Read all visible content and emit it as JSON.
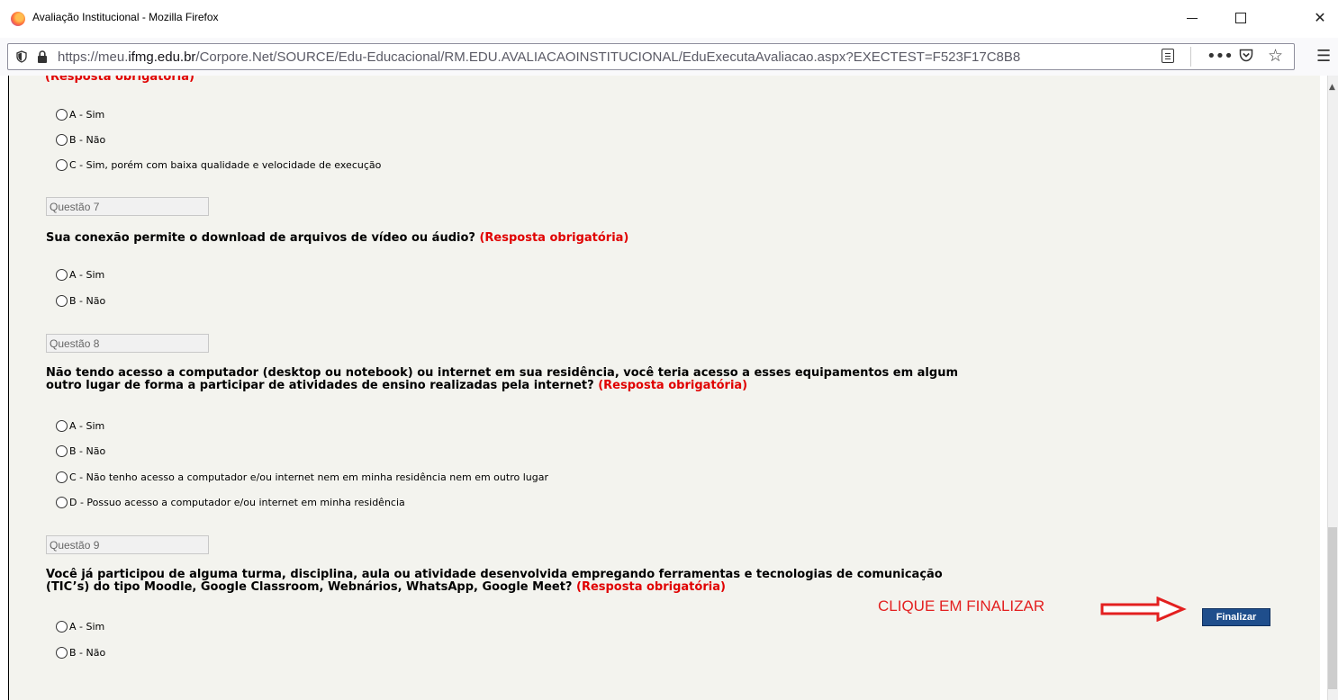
{
  "window": {
    "title": "Avaliação Institucional - Mozilla Firefox",
    "minimize": "",
    "maximize": "",
    "close": "✕"
  },
  "urlbar": {
    "url_prefix": "https://meu.",
    "url_domain": "ifmg.edu.br",
    "url_path": "/Corpore.Net/SOURCE/Edu-Educacional/RM.EDU.AVALIACAOINSTITUCIONAL/EduExecutaAvaliacao.aspx?EXECTEST=F523F17C8B8",
    "more": "•••",
    "star": "☆",
    "menu": "☰"
  },
  "form": {
    "cut_off_text": "(Resposta obrigatória)",
    "q6_options": [
      "A - Sim",
      "B - Não",
      "C - Sim, porém com baixa qualidade e velocidade de execução"
    ],
    "q7": {
      "label": "Questão 7",
      "text": "Sua conexão permite o download de arquivos de vídeo ou áudio?",
      "required": "(Resposta obrigatória)",
      "options": [
        "A - Sim",
        "B - Não"
      ]
    },
    "q8": {
      "label": "Questão 8",
      "text_line1": "Não tendo acesso a computador (desktop ou notebook) ou internet em sua residência, você teria acesso a esses equipamentos em algum",
      "text_line2": "outro lugar de forma a participar de atividades de ensino realizadas pela internet?",
      "required": "(Resposta obrigatória)",
      "options": [
        "A - Sim",
        "B - Não",
        "C - Não tenho acesso a computador e/ou internet nem em minha residência nem em outro lugar",
        "D - Possuo acesso a computador e/ou internet em minha residência"
      ]
    },
    "q9": {
      "label": "Questão 9",
      "text_line1": "Você já participou de alguma turma, disciplina, aula ou atividade desenvolvida empregando ferramentas e tecnologias de comunicação",
      "text_line2": "(TIC’s) do tipo Moodle, Google Classroom, Webnários, WhatsApp, Google Meet?",
      "required": "(Resposta obrigatória)",
      "options": [
        "A - Sim",
        "B - Não"
      ]
    }
  },
  "footer": {
    "cta_text": "CLIQUE EM FINALIZAR",
    "finalize_label": "Finalizar"
  },
  "colors": {
    "required_red": "#e00000",
    "button_blue": "#1f4e8c",
    "page_bg": "#f3f3ee"
  }
}
